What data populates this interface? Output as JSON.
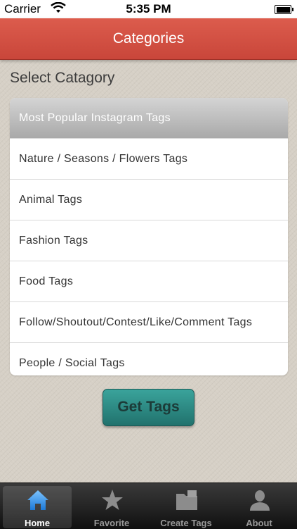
{
  "status_bar": {
    "carrier": "Carrier",
    "time": "5:35 PM"
  },
  "nav": {
    "title": "Categories"
  },
  "section_label": "Select Catagory",
  "categories": [
    {
      "label": "Most Popular Instagram Tags",
      "selected": true
    },
    {
      "label": "Nature / Seasons / Flowers Tags",
      "selected": false
    },
    {
      "label": "Animal Tags",
      "selected": false
    },
    {
      "label": "Fashion Tags",
      "selected": false
    },
    {
      "label": "Food Tags",
      "selected": false
    },
    {
      "label": "Follow/Shoutout/Contest/Like/Comment Tags",
      "selected": false
    },
    {
      "label": "People / Social Tags",
      "selected": false
    }
  ],
  "button": {
    "label": "Get Tags"
  },
  "tabs": [
    {
      "label": "Home",
      "icon": "home-icon",
      "active": true
    },
    {
      "label": "Favorite",
      "icon": "star-icon",
      "active": false
    },
    {
      "label": "Create Tags",
      "icon": "folder-icon",
      "active": false
    },
    {
      "label": "About",
      "icon": "person-icon",
      "active": false
    }
  ],
  "colors": {
    "nav_red": "#d3503f",
    "button_teal": "#2c8a83",
    "tab_bar": "#1c1c1c"
  }
}
